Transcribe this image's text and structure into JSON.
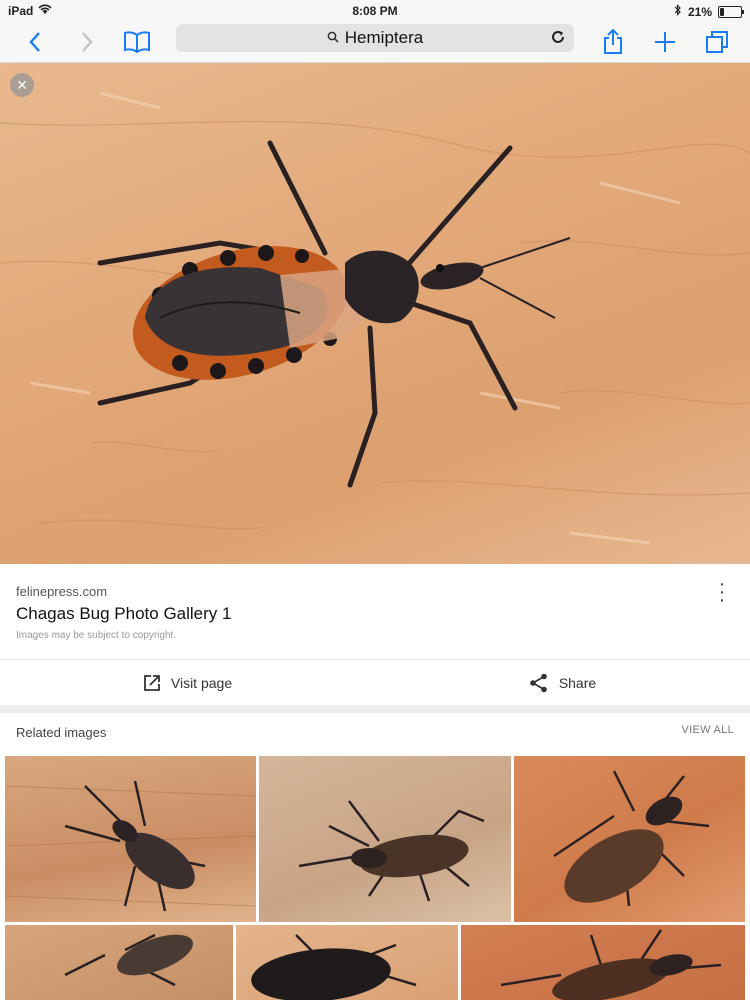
{
  "status_bar": {
    "device": "iPad",
    "time": "8:08 PM",
    "battery": "21%",
    "battery_level": 0.21
  },
  "toolbar": {
    "url_text": "Hemiptera"
  },
  "result": {
    "source": "felinepress.com",
    "title": "Chagas Bug Photo Gallery 1",
    "copyright": "Images may be subject to copyright.",
    "visit_label": "Visit page",
    "share_label": "Share"
  },
  "related": {
    "heading": "Related images",
    "view_all": "VIEW ALL"
  },
  "colors": {
    "accent": "#1a7cf2",
    "bg": "#ececec"
  }
}
